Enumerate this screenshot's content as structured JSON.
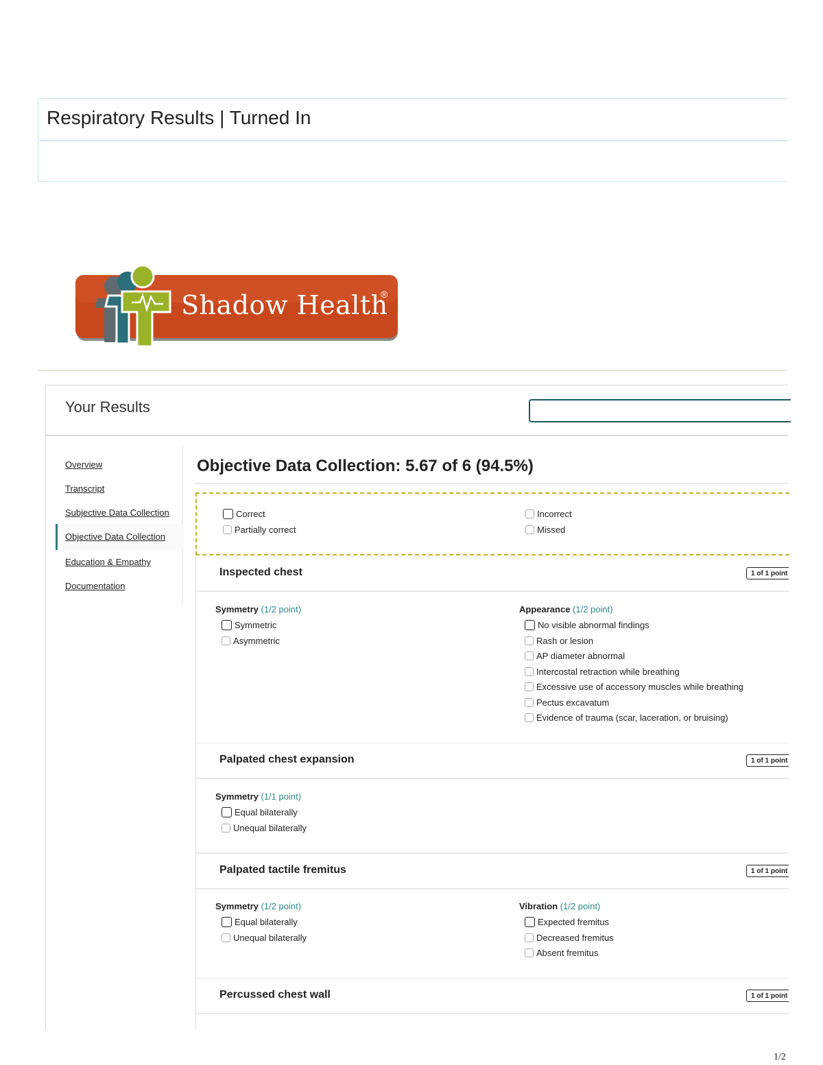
{
  "page": {
    "title": "Respiratory Results | Turned In",
    "page_number": "1/2"
  },
  "logo": {
    "text": "Shadow Health",
    "mark": "®",
    "colors": {
      "orange": "#c9471c",
      "green": "#9ab227",
      "teal": "#2a6f7a"
    }
  },
  "results": {
    "header": "Your Results",
    "nav": [
      {
        "label": "Overview"
      },
      {
        "label": "Transcript"
      },
      {
        "label": "Subjective Data Collection"
      },
      {
        "label": "Objective Data Collection"
      },
      {
        "label": "Education & Empathy"
      },
      {
        "label": "Documentation"
      }
    ],
    "main_title": "Objective Data Collection: 5.67 of 6 (94.5%)",
    "legend": {
      "correct": "Correct",
      "partial": "Partially correct",
      "incorrect": "Incorrect",
      "missed": "Missed"
    },
    "sections": [
      {
        "title": "Inspected chest",
        "points": "1 of 1 point",
        "groups": [
          {
            "name": "Symmetry",
            "points": "(1/2 point)",
            "options": [
              "Symmetric",
              "Asymmetric"
            ]
          },
          {
            "name": "Appearance",
            "points": "(1/2 point)",
            "options": [
              "No visible abnormal findings",
              "Rash or lesion",
              "AP diameter abnormal",
              "Intercostal retraction while breathing",
              "Excessive use of accessory muscles while breathing",
              "Pectus excavatum",
              "Evidence of trauma (scar, laceration, or bruising)"
            ]
          }
        ]
      },
      {
        "title": "Palpated chest expansion",
        "points": "1 of 1 point",
        "groups": [
          {
            "name": "Symmetry",
            "points": "(1/1 point)",
            "options": [
              "Equal bilaterally",
              "Unequal bilaterally"
            ]
          }
        ]
      },
      {
        "title": "Palpated tactile fremitus",
        "points": "1 of 1 point",
        "groups": [
          {
            "name": "Symmetry",
            "points": "(1/2 point)",
            "options": [
              "Equal bilaterally",
              "Unequal bilaterally"
            ]
          },
          {
            "name": "Vibration",
            "points": "(1/2 point)",
            "options": [
              "Expected fremitus",
              "Decreased fremitus",
              "Absent fremitus"
            ]
          }
        ]
      },
      {
        "title": "Percussed chest wall",
        "points": "1 of 1 point",
        "groups": []
      }
    ]
  }
}
